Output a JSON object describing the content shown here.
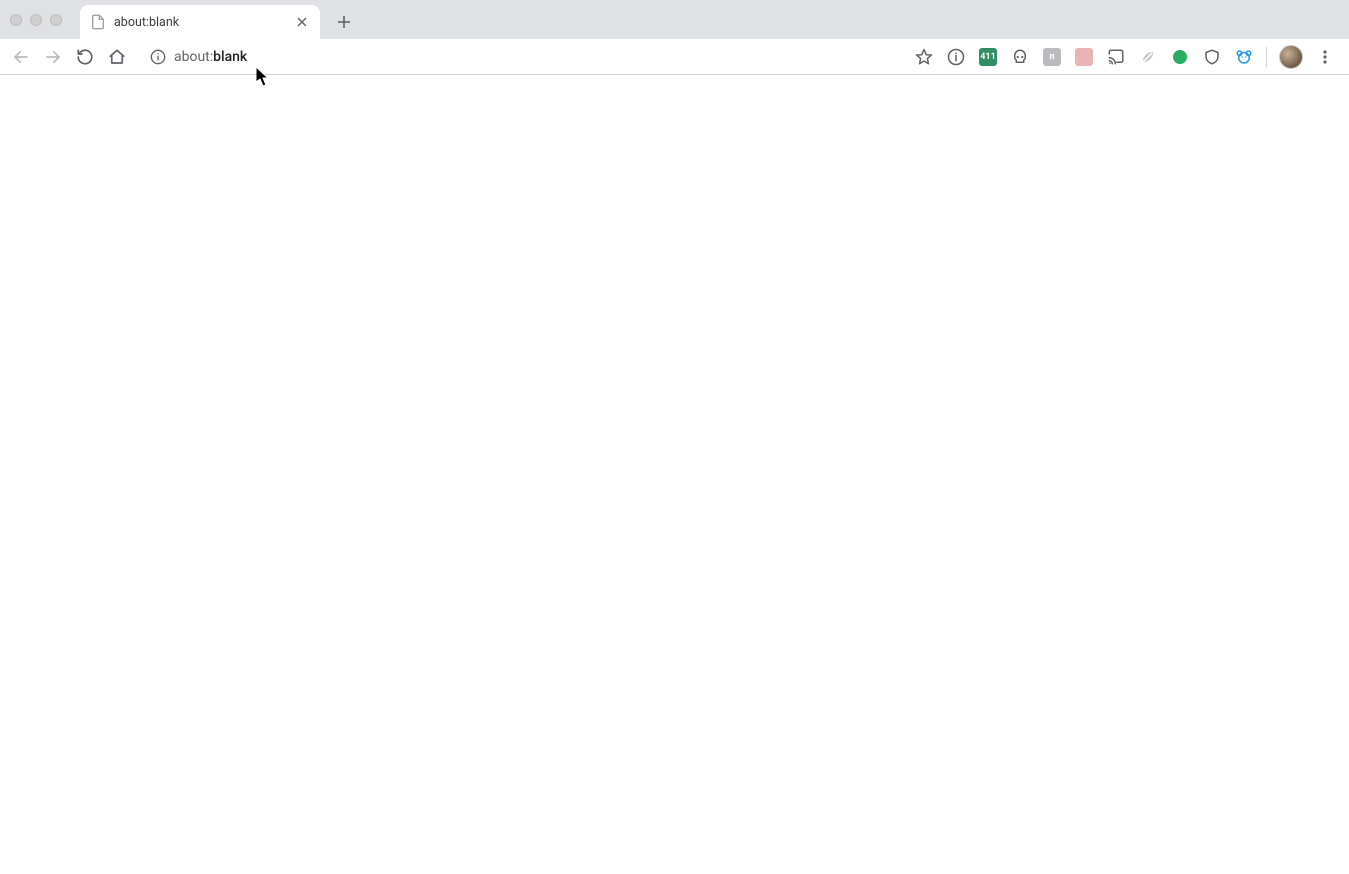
{
  "tab": {
    "title": "about:blank"
  },
  "address": {
    "scheme": "about:",
    "rest": "blank"
  },
  "extensions": [
    {
      "name": "ext-info",
      "kind": "info"
    },
    {
      "name": "ext-411",
      "kind": "sq",
      "bg": "#2d8f63",
      "text": "411"
    },
    {
      "name": "ext-skull",
      "kind": "skull"
    },
    {
      "name": "ext-n-gray",
      "kind": "sq",
      "bg": "#b9bbbe",
      "text": "n"
    },
    {
      "name": "ext-stripes",
      "kind": "sq",
      "bg": "#e8b4b4",
      "text": ""
    },
    {
      "name": "ext-cast",
      "kind": "cast"
    },
    {
      "name": "ext-leaf",
      "kind": "leaf"
    },
    {
      "name": "ext-green-dot",
      "kind": "dot",
      "bg": "#27ae60"
    },
    {
      "name": "ext-shield",
      "kind": "shield"
    },
    {
      "name": "ext-bear",
      "kind": "bear"
    }
  ]
}
